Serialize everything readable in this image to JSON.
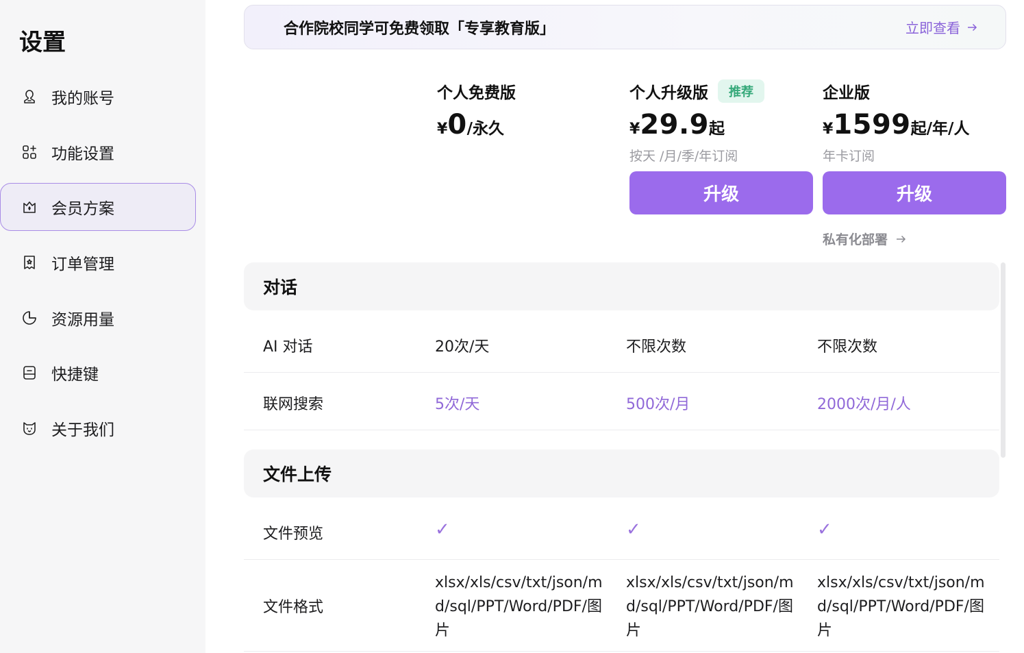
{
  "sidebar": {
    "title": "设置",
    "items": [
      {
        "label": "我的账号",
        "icon": "user-icon"
      },
      {
        "label": "功能设置",
        "icon": "apps-icon"
      },
      {
        "label": "会员方案",
        "icon": "crown-bag-icon",
        "active": true
      },
      {
        "label": "订单管理",
        "icon": "receipt-icon"
      },
      {
        "label": "资源用量",
        "icon": "pie-chart-icon"
      },
      {
        "label": "快捷键",
        "icon": "keyboard-icon"
      },
      {
        "label": "关于我们",
        "icon": "cat-face-icon"
      }
    ]
  },
  "banner": {
    "text": "合作院校同学可免费领取「专享教育版」",
    "link_label": "立即查看"
  },
  "plans": [
    {
      "name": "个人免费版",
      "currency": "¥",
      "price": "0",
      "suffix": "/永久",
      "sub": ""
    },
    {
      "name": "个人升级版",
      "badge": "推荐",
      "currency": "¥",
      "price": "29.9",
      "suffix": "起",
      "sub": "按天 /月/季/年订阅",
      "button": "升级"
    },
    {
      "name": "企业版",
      "currency": "¥",
      "price": "1599",
      "suffix": "起/年/人",
      "sub": "年卡订阅",
      "button": "升级",
      "extra_link": "私有化部署"
    }
  ],
  "sections": [
    {
      "title": "对话",
      "rows": [
        {
          "feature": "AI 对话",
          "values": [
            "20次/天",
            "不限次数",
            "不限次数"
          ]
        },
        {
          "feature": "联网搜索",
          "values": [
            "5次/天",
            "500次/月",
            "2000次/月/人"
          ]
        }
      ]
    },
    {
      "title": "文件上传",
      "rows": [
        {
          "feature": "文件预览",
          "values": [
            "✓",
            "✓",
            "✓"
          ]
        },
        {
          "feature": "文件格式",
          "values": [
            "xlsx/xls/csv/txt/json/md/sql/PPT/Word/PDF/图片",
            "xlsx/xls/csv/txt/json/md/sql/PPT/Word/PDF/图片",
            "xlsx/xls/csv/txt/json/md/sql/PPT/Word/PDF/图片"
          ]
        }
      ]
    }
  ],
  "colors": {
    "accent": "#9b6bec",
    "accent_text": "#9068d8",
    "badge_bg": "#e2f6ee",
    "badge_text": "#36a97a",
    "sidebar_bg": "#f6f6f7"
  }
}
